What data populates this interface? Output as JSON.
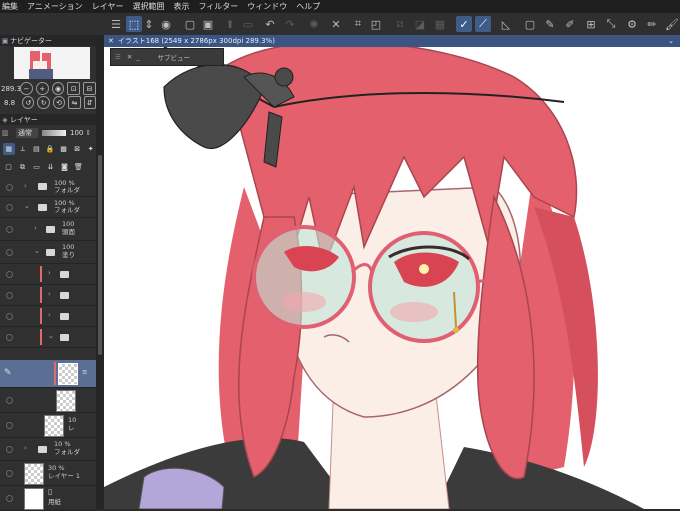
{
  "menu": [
    "編集",
    "アニメーション",
    "レイヤー",
    "選択範囲",
    "表示",
    "フィルター",
    "ウィンドウ",
    "ヘルプ"
  ],
  "toolbar_icons": [
    "menu-icon",
    "transform-icon",
    "mirror-icon",
    "layer-view-icon",
    "new-canvas-icon",
    "save-icon",
    "export-icon",
    "folder-icon",
    "undo-icon",
    "redo-icon",
    "loading-icon",
    "clear-icon",
    "crop-icon",
    "ruler-off-icon",
    "ruler-icon",
    "snap-icon",
    "pen-snap-icon",
    "pen-icon",
    "fit-icon",
    "brush-icon",
    "brush-alt-icon",
    "grid-icon",
    "resize-icon",
    "settings-icon"
  ],
  "navigator": {
    "title": "ナビゲーター",
    "zoom": "289.3",
    "rotation": "8.8"
  },
  "layer_panel": {
    "title": "レイヤー",
    "blend_mode": "通常",
    "opacity": "100",
    "rows": [
      {
        "opacity": "100 %",
        "name": "フォルダ"
      },
      {
        "opacity": "100 %",
        "name": "フォルダ"
      },
      {
        "opacity": "100",
        "name": "頭面"
      },
      {
        "opacity": "100",
        "name": "塗り"
      },
      {
        "opacity": "",
        "name": ""
      },
      {
        "opacity": "",
        "name": ""
      },
      {
        "opacity": "",
        "name": ""
      },
      {
        "opacity": "",
        "name": ""
      },
      {
        "opacity": "",
        "name": ""
      },
      {
        "opacity": "10",
        "name": "レ"
      },
      {
        "opacity": "10 %",
        "name": "フォルダ"
      },
      {
        "opacity": "30 %",
        "name": "レイヤー 1"
      },
      {
        "opacity": "",
        "name": "用紙"
      }
    ]
  },
  "document_tab": "イラスト168 (2549 x 2786px 300dpi 289.3%)",
  "subview": {
    "title": "サブビュー"
  },
  "colors": {
    "hair": "#e4606d",
    "hair_shadow": "#c8465a",
    "skin": "#fbeee6",
    "accent": "#3b5482",
    "glasses": "#e06072",
    "lens": "#bfe6d8",
    "ribbon": "#4a4a4a",
    "clothes": "#3b3b3b"
  }
}
